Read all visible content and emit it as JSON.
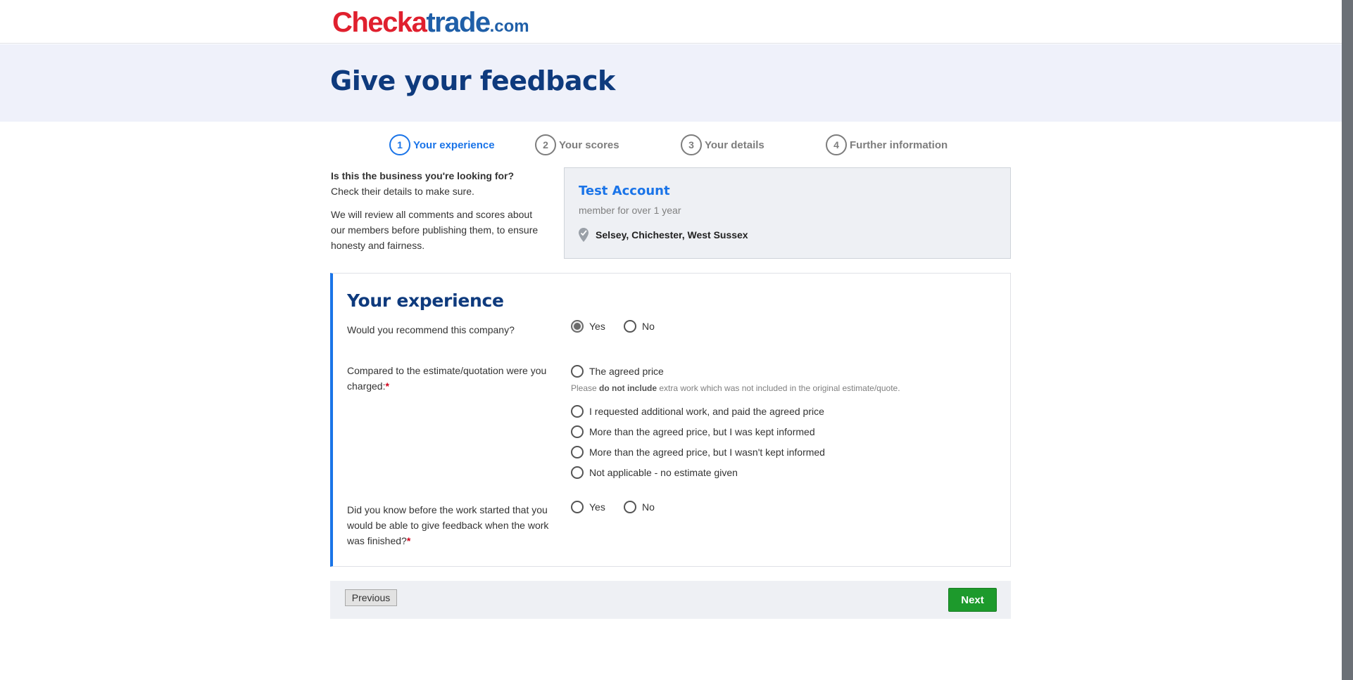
{
  "header": {
    "logo": {
      "part1": "Chec",
      "part2": "k",
      "part3": "a",
      "part4": "trade",
      "part5": ".com"
    }
  },
  "hero": {
    "title": "Give your feedback"
  },
  "steps": [
    {
      "num": "1",
      "label": "Your experience",
      "active": true
    },
    {
      "num": "2",
      "label": "Your scores",
      "active": false
    },
    {
      "num": "3",
      "label": "Your details",
      "active": false
    },
    {
      "num": "4",
      "label": "Further information",
      "active": false
    }
  ],
  "intro": {
    "question": "Is this the business you're looking for?",
    "check": "Check their details to make sure.",
    "review": "We will review all comments and scores about our members before publishing them, to ensure honesty and fairness."
  },
  "business": {
    "name": "Test Account",
    "member": "member for over 1 year",
    "location": "Selsey, Chichester, West Sussex"
  },
  "experience": {
    "title": "Your experience",
    "q1": {
      "label": "Would you recommend this company?",
      "options": [
        "Yes",
        "No"
      ],
      "selected": "Yes"
    },
    "q2": {
      "label": "Compared to the estimate/quotation were you charged:",
      "required": "*",
      "options": [
        "The agreed price",
        "I requested additional work, and paid the agreed price",
        "More than the agreed price, but I was kept informed",
        "More than the agreed price, but I wasn't kept informed",
        "Not applicable - no estimate given"
      ],
      "hint_pre": "Please ",
      "hint_bold": "do not include",
      "hint_post": " extra work which was not included in the original estimate/quote."
    },
    "q3": {
      "label": "Did you know before the work started that you would be able to give feedback when the work was finished?",
      "required": "*",
      "options": [
        "Yes",
        "No"
      ]
    }
  },
  "nav": {
    "previous": "Previous",
    "next": "Next"
  },
  "colors": {
    "brand_blue": "#0e3a7d",
    "accent_blue": "#1a74e8",
    "logo_red": "#e0202e",
    "next_green": "#1d9a2c"
  }
}
